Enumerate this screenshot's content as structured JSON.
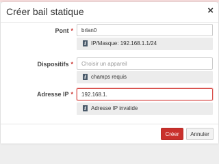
{
  "dialog": {
    "title": "Créer bail statique",
    "close_glyph": "×"
  },
  "form": {
    "bridge": {
      "label": "Pont",
      "required_mark": "*",
      "value": "brlan0",
      "info": "IP/Masque: 192.168.1.1/24"
    },
    "device": {
      "label": "Dispositifs",
      "required_mark": "*",
      "placeholder": "Choisir un appareil",
      "value": "",
      "info": "champs requis"
    },
    "ip": {
      "label": "Adresse IP",
      "required_mark": "*",
      "value": "192.168.1.",
      "info": "Adresse IP invalide"
    }
  },
  "footer": {
    "create_label": "Créer",
    "cancel_label": "Annuler"
  },
  "colors": {
    "primary": "#c9302c",
    "error_border": "#d9534f",
    "help_bg": "#ececec",
    "info_icon": "#4a5a6a"
  },
  "icons": {
    "info": "info-icon",
    "close": "close-icon"
  }
}
